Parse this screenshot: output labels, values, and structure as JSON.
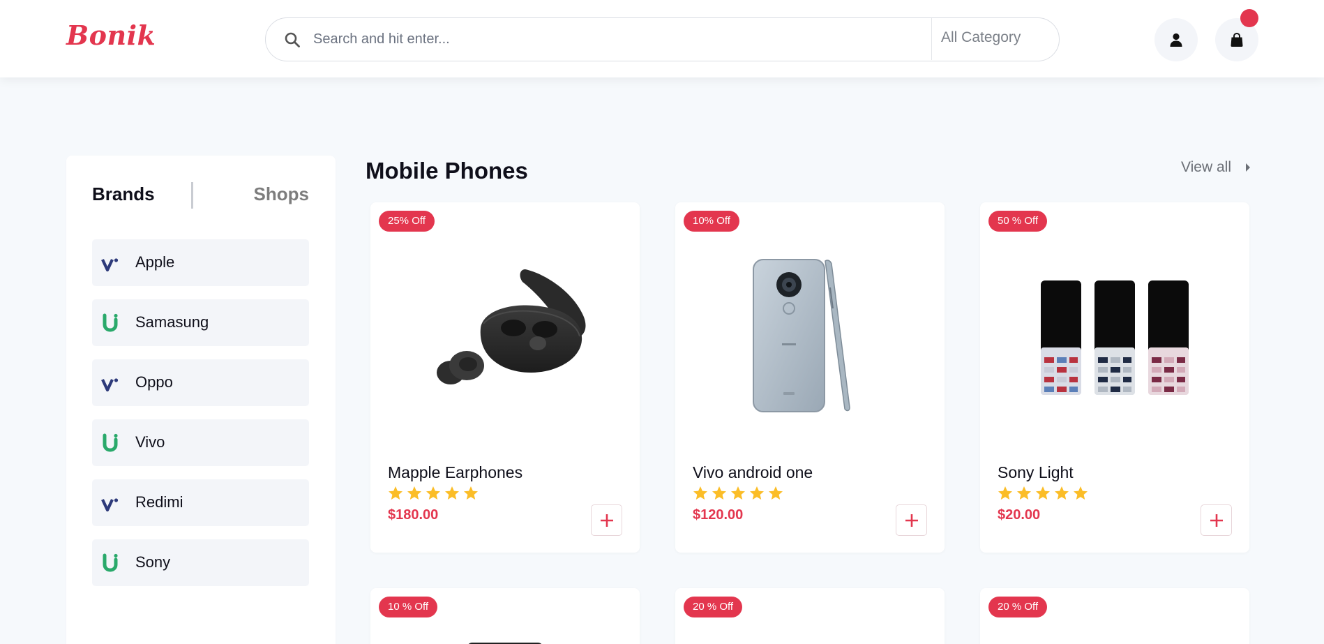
{
  "header": {
    "logo": "Bonik",
    "search": {
      "placeholder": "Search and hit enter...",
      "value": ""
    },
    "category": "All Category",
    "cart_count": ""
  },
  "sidebar": {
    "tabs": [
      "Brands",
      "Shops"
    ],
    "active_tab": "Brands",
    "brands": [
      {
        "label": "Apple",
        "logo": "v-logo-icon"
      },
      {
        "label": "Samasung",
        "logo": "u-logo-icon"
      },
      {
        "label": "Oppo",
        "logo": "v-logo-icon"
      },
      {
        "label": "Vivo",
        "logo": "u-logo-icon"
      },
      {
        "label": "Redimi",
        "logo": "v-logo-icon"
      },
      {
        "label": "Sony",
        "logo": "u-logo-icon"
      }
    ]
  },
  "section": {
    "title": "Mobile Phones",
    "view_all": "View all"
  },
  "products": [
    {
      "badge": "25% Off",
      "name": "Mapple Earphones",
      "rating": 5,
      "price": "$180.00",
      "image": "earbuds-image"
    },
    {
      "badge": "10% Off",
      "name": "Vivo android one",
      "rating": 5,
      "price": "$120.00",
      "image": "smartphone-image"
    },
    {
      "badge": "50 % Off",
      "name": "Sony Light",
      "rating": 5,
      "price": "$20.00",
      "image": "feature-phones-image"
    },
    {
      "badge": "10 % Off"
    },
    {
      "badge": "20 % Off"
    },
    {
      "badge": "20 % Off"
    }
  ],
  "colors": {
    "accent": "#e3364e",
    "star": "#fbbd27",
    "page_bg": "#f6f9fc",
    "brand_v": "#2d3a7a",
    "brand_u": "#2aa96b"
  }
}
